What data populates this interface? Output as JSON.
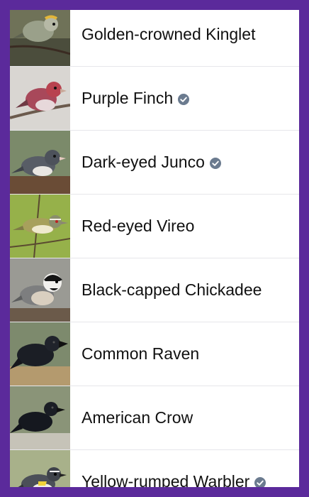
{
  "colors": {
    "frame": "#5b2a9b",
    "verified_badge": "#6b7b8f",
    "divider": "#e6e6ea"
  },
  "birds": [
    {
      "name": "Golden-crowned Kinglet",
      "verified": false,
      "icon": "kinglet-photo"
    },
    {
      "name": "Purple Finch",
      "verified": true,
      "icon": "finch-photo"
    },
    {
      "name": "Dark-eyed Junco",
      "verified": true,
      "icon": "junco-photo"
    },
    {
      "name": "Red-eyed Vireo",
      "verified": false,
      "icon": "vireo-photo"
    },
    {
      "name": "Black-capped Chickadee",
      "verified": false,
      "icon": "chickadee-photo"
    },
    {
      "name": "Common Raven",
      "verified": false,
      "icon": "raven-photo"
    },
    {
      "name": "American Crow",
      "verified": false,
      "icon": "crow-photo"
    },
    {
      "name": "Yellow-rumped Warbler",
      "verified": true,
      "icon": "warbler-photo"
    }
  ]
}
